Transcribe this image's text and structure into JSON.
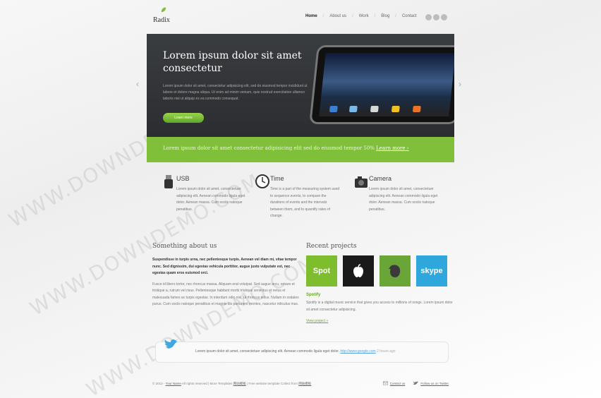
{
  "header": {
    "logo_text": "Radix",
    "nav": [
      "Home",
      "About us",
      "Work",
      "Blog",
      "Contact"
    ],
    "nav_separator": "/"
  },
  "hero": {
    "title": "Lorem ipsum dolor sit amet consectetur",
    "text": "Lorem ipsum dolor sit amet, consectetur adipisicing elit, sed do eiusmod tempor incididunt ut labore et dolore magna aliqua. Ut enim ad minim veniam, quis nostrud exercitation ullamco laboris nisi ut aliquip ex ea commodo consequat.",
    "button": "Learn more",
    "prev_arrow": "‹",
    "next_arrow": "›"
  },
  "banner": {
    "text": "Lorem ipsum dolor sit amet consectetur adipisicing elit sed do eiusmod tempor 50% ",
    "link": "Learn more ›"
  },
  "features": [
    {
      "title": "USB",
      "icon": "usb-icon",
      "text": "Lorem ipsum dolor sit amet, consectetuer adipiscing elit. Aenean commodo ligula eget dolor. Aenean massa. Cum sociis natoque penatibus."
    },
    {
      "title": "Time",
      "icon": "clock-icon",
      "text": "Time is a part of the measuring system used to sequence events, to compare the durations of events and the intervals between them, and to quantify rates of change."
    },
    {
      "title": "Camera",
      "icon": "camera-icon",
      "text": "Lorem ipsum dolor sit amet, consectetuer adipiscing elit. Aenean commodo ligula eget dolor. Aenean massa. Cum sociis natoque penatibus."
    }
  ],
  "about": {
    "title": "Something about us",
    "bold": "Suspendisse in turpis urna, nec pellentesque turpis. Aenean vel diam mi, vitae tempor nunc. Sed dignissim, dui egestas vehicula porttitor, augue justo vulputate est, nec egestas quam eros euismod orci.",
    "text": "Fusce id libero tortor, nec rhoncus massa. Aliquam erat volutpat. Sed augue arcu, ornare et tristique a, rutrum vel risus. Pellentesque habitant morbi tristique senectus et netus et malesuada fames ac turpis egestas. In interdum odio nisl, ut rhoncus tellus. Nullam in sodales purus. Cum sociis natoque penatibus et magnis dis parturient montes, nascetur ridiculus mus."
  },
  "projects": {
    "title": "Recent projects",
    "thumbs": [
      {
        "label": "Spot",
        "color": "#7dbd2e"
      },
      {
        "label": "",
        "color": "#1a1a1a"
      },
      {
        "label": "",
        "color": "#6aa538"
      },
      {
        "label": "skype",
        "color": "#2ea7dd"
      }
    ],
    "name": "Spotify",
    "text": "Spotify is a digital music service that gives you access to millions of songs. Lorem ipsum dolor sit amet consectetur adipisicing.",
    "link": "View project »"
  },
  "tweet": {
    "text": "Lorem ipsum dolor sit amet, consectetuer adipiscing elit. Aenean commodo ligula eget dolor. ",
    "link": "http://www.google.com",
    "time": "2 hours ago"
  },
  "footer": {
    "copyright": "© 2012 - ",
    "your_name": "Your Name",
    "rights": " All rights reserved | More Templates ",
    "link1": "网站模板",
    "middle": " | Free website template Collect from ",
    "link2": "网站模板",
    "contact": "Contact us",
    "twitter": "Follow us on Twitter"
  },
  "watermark": "WWW.DOWNDEMO.COM",
  "colors": {
    "accent": "#7fbf3a",
    "hero_bg": "#2f3134",
    "link": "#6aa72b"
  }
}
